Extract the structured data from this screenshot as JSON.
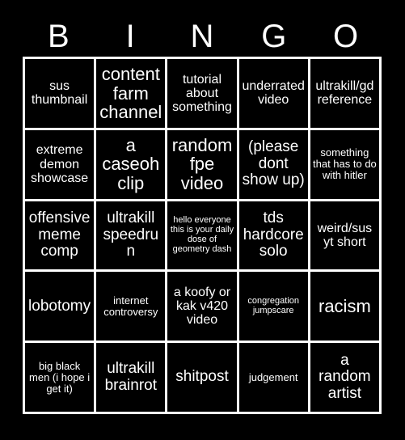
{
  "card": {
    "title_letters": [
      "B",
      "I",
      "N",
      "G",
      "O"
    ],
    "background_color": "#000000",
    "grid_line_color": "#ffffff",
    "text_color": "#ffffff",
    "rows": 5,
    "columns": 5,
    "cells": [
      {
        "text": "sus thumbnail",
        "size": "size-md"
      },
      {
        "text": "content farm channel",
        "size": "size-xl"
      },
      {
        "text": "tutorial about something",
        "size": "size-md"
      },
      {
        "text": "underrated video",
        "size": "size-md"
      },
      {
        "text": "ultrakill/gd reference",
        "size": "size-md"
      },
      {
        "text": "extreme demon showcase",
        "size": "size-md"
      },
      {
        "text": "a caseoh clip",
        "size": "size-xl"
      },
      {
        "text": "random fpe video",
        "size": "size-xl"
      },
      {
        "text": "(please dont show up)",
        "size": "size-lg"
      },
      {
        "text": "something that has to do with hitler",
        "size": "size-sm"
      },
      {
        "text": "offensive meme comp",
        "size": "size-lg"
      },
      {
        "text": "ultrakill speedrun",
        "size": "size-lg"
      },
      {
        "text": "hello everyone this is your daily dose of geometry dash",
        "size": "size-xs"
      },
      {
        "text": "tds hardcore solo",
        "size": "size-lg"
      },
      {
        "text": "weird/sus yt short",
        "size": "size-md"
      },
      {
        "text": "lobotomy",
        "size": "size-lg"
      },
      {
        "text": "internet controversy",
        "size": "size-sm"
      },
      {
        "text": "a koofy or kak v420 video",
        "size": "size-md"
      },
      {
        "text": "congregation jumpscare",
        "size": "size-xs"
      },
      {
        "text": "racism",
        "size": "size-xl"
      },
      {
        "text": "big black men (i hope i get it)",
        "size": "size-sm"
      },
      {
        "text": "ultrakill brainrot",
        "size": "size-lg"
      },
      {
        "text": "shitpost",
        "size": "size-lg"
      },
      {
        "text": "judgement",
        "size": "size-sm"
      },
      {
        "text": "a random artist",
        "size": "size-lg"
      }
    ]
  }
}
